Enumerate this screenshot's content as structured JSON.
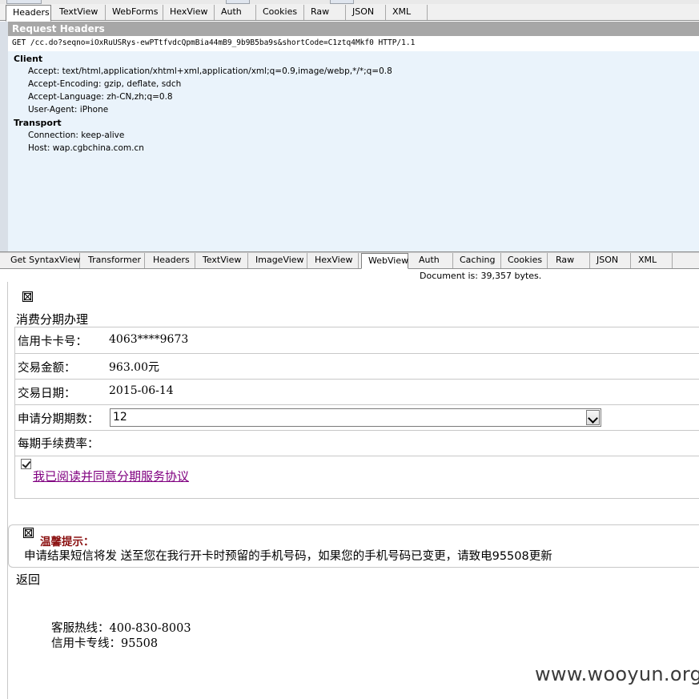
{
  "inspector_tabs": [
    "Headers",
    "TextView",
    "WebForms",
    "HexView",
    "Auth",
    "Cookies",
    "Raw",
    "JSON",
    "XML"
  ],
  "request_headers": {
    "title": "Request Headers",
    "request_line": "GET /cc.do?seqno=iOxRuUSRys-ewPTtfvdcQpmBia44mB9_9b9B5ba9s&shortCode=C1ztq4Mkf0 HTTP/1.1",
    "groups": [
      {
        "name": "Client",
        "headers": [
          "Accept: text/html,application/xhtml+xml,application/xml;q=0.9,image/webp,*/*;q=0.8",
          "Accept-Encoding: gzip, deflate, sdch",
          "Accept-Language: zh-CN,zh;q=0.8",
          "User-Agent: iPhone"
        ]
      },
      {
        "name": "Transport",
        "headers": [
          "Connection: keep-alive",
          "Host: wap.cgbchina.com.cn"
        ]
      }
    ]
  },
  "response_tabs": [
    "Get SyntaxView",
    "Transformer",
    "Headers",
    "TextView",
    "ImageView",
    "HexView",
    "WebView",
    "Auth",
    "Caching",
    "Cookies",
    "Raw",
    "JSON",
    "XML"
  ],
  "doc_info": "Document is: 39,357 bytes.",
  "web": {
    "section_title": "消费分期办理",
    "card_label": "信用卡卡号：",
    "card_value": "4063****9673",
    "amount_label": "交易金额：",
    "amount_value": "963.00元",
    "date_label": "交易日期：",
    "date_value": "2015-06-14",
    "installments_label": "申请分期期数：",
    "installments_value": "12",
    "fee_label": "每期手续费率：",
    "agree_link": "我已阅读并同意分期服务协议",
    "agree_checked": true,
    "notice_title": "温馨提示：",
    "notice_text": "申请结果短信将发 送至您在我行开卡时预留的手机号码，如果您的手机号码已变更，请致电95508更新",
    "back_link": "返回",
    "hotline_service": "客服热线：400-830-8003",
    "hotline_card": "信用卡专线：95508"
  },
  "watermark": "www.wooyun.org",
  "colors": {
    "notice_title": "#8b1010",
    "link_visited": "#800080",
    "headers_bg": "#eaf3fb",
    "panel_title_bg": "#a7a7a7"
  }
}
